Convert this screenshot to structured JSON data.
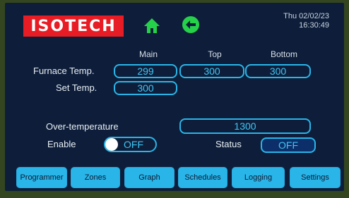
{
  "header": {
    "logo_text": "ISOTECH",
    "home_icon": "home-icon",
    "back_icon": "back-arrow-icon",
    "date": "Thu 02/02/23",
    "time": "16:30:49"
  },
  "columns": {
    "main": "Main",
    "top": "Top",
    "bottom": "Bottom"
  },
  "furnace_temp": {
    "label": "Furnace Temp.",
    "main": "299",
    "top": "300",
    "bottom": "300"
  },
  "set_temp": {
    "label": "Set Temp.",
    "value": "300"
  },
  "over_temperature": {
    "label": "Over-temperature",
    "value": "1300"
  },
  "enable": {
    "label": "Enable",
    "state": "OFF"
  },
  "status": {
    "label": "Status",
    "value": "OFF"
  },
  "nav": {
    "items": [
      {
        "label": "Programmer"
      },
      {
        "label": "Zones"
      },
      {
        "label": "Graph"
      },
      {
        "label": "Schedules"
      },
      {
        "label": "Logging"
      },
      {
        "label": "Settings"
      }
    ]
  },
  "colors": {
    "accent": "#29b5e8",
    "logo_red": "#e81c24",
    "icon_green": "#26d14a",
    "screen_bg": "#0e1e3a"
  }
}
